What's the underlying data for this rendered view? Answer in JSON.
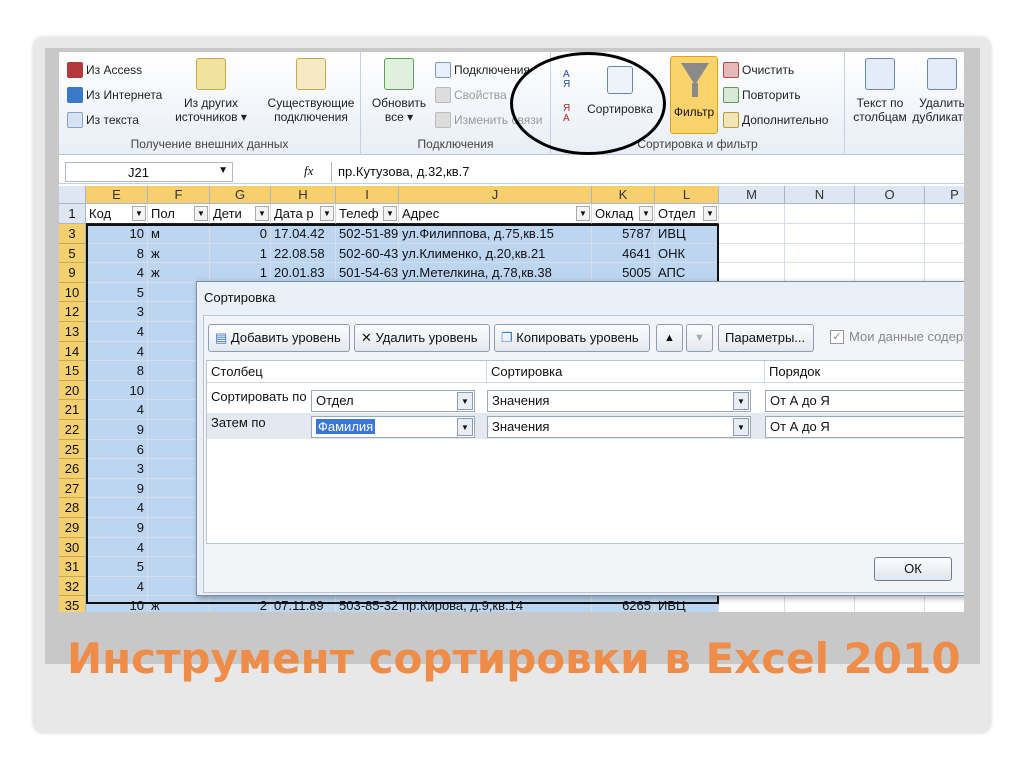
{
  "ribbon": {
    "external_data": {
      "from_access": "Из Access",
      "from_web": "Из Интернета",
      "from_text": "Из текста",
      "other_sources": [
        "Из других",
        "источников ▾"
      ],
      "existing_connections": [
        "Существующие",
        "подключения"
      ],
      "group_label": "Получение внешних данных"
    },
    "connections": {
      "refresh_all": [
        "Обновить",
        "все ▾"
      ],
      "connections": "Подключения",
      "properties": "Свойства",
      "edit_links": "Изменить связи",
      "group_label": "Подключения"
    },
    "sort_filter": {
      "sort": "Сортировка",
      "filter": "Фильтр",
      "clear": "Очистить",
      "reapply": "Повторить",
      "advanced": "Дополнительно",
      "group_label": "Сортировка и фильтр",
      "az_glyph": "А Я",
      "za_glyph": "Я А"
    },
    "tools": {
      "text_to_columns": [
        "Текст по",
        "столбцам"
      ],
      "remove_duplicates": [
        "Удалить",
        "дубликаты"
      ]
    }
  },
  "formula_bar": {
    "name_box": "J21",
    "fx": "fx",
    "value": "пр.Кутузова, д.32,кв.7"
  },
  "sheet": {
    "columns": [
      "E",
      "F",
      "G",
      "H",
      "I",
      "J",
      "K",
      "L",
      "M",
      "N",
      "O",
      "P"
    ],
    "header_row": {
      "row_num": "1",
      "cells": [
        "Код",
        "Пол",
        "Дети",
        "Дата р",
        "Телеф",
        "Адрес",
        "Оклад",
        "Отдел"
      ]
    },
    "rows": [
      {
        "num": "3",
        "code": "10",
        "sex": "м",
        "kids": "0",
        "date": "17.04.42",
        "phone": "502-51-89",
        "address": "ул.Филиппова, д.75,кв.15",
        "salary": "5787",
        "dept": "ИВЦ"
      },
      {
        "num": "5",
        "code": "8",
        "sex": "ж",
        "kids": "1",
        "date": "22.08.58",
        "phone": "502-60-43",
        "address": "ул.Клименко, д.20,кв.21",
        "salary": "4641",
        "dept": "ОНК"
      },
      {
        "num": "9",
        "code": "4",
        "sex": "ж",
        "kids": "1",
        "date": "20.01.83",
        "phone": "501-54-63",
        "address": "ул.Метелкина, д.78,кв.38",
        "salary": "5005",
        "dept": "АПС"
      },
      {
        "num": "10",
        "code": "5"
      },
      {
        "num": "12",
        "code": "3"
      },
      {
        "num": "13",
        "code": "4"
      },
      {
        "num": "14",
        "code": "4"
      },
      {
        "num": "15",
        "code": "8"
      },
      {
        "num": "20",
        "code": "10"
      },
      {
        "num": "21",
        "code": "4"
      },
      {
        "num": "22",
        "code": "9"
      },
      {
        "num": "25",
        "code": "6"
      },
      {
        "num": "26",
        "code": "3"
      },
      {
        "num": "27",
        "code": "9"
      },
      {
        "num": "28",
        "code": "4"
      },
      {
        "num": "29",
        "code": "9"
      },
      {
        "num": "30",
        "code": "4"
      },
      {
        "num": "31",
        "code": "5"
      },
      {
        "num": "32",
        "code": "4"
      },
      {
        "num": "35",
        "code": "10",
        "sex": "ж",
        "kids": "2",
        "date": "07.11.89",
        "phone": "503-85-32",
        "address": "пр.Кирова, д.9,кв.14",
        "salary": "6265",
        "dept": "ИВЦ"
      }
    ]
  },
  "dialog": {
    "title": "Сортировка",
    "add_level": "Добавить уровень",
    "delete_level": "Удалить уровень",
    "copy_level": "Копировать уровень",
    "up": "▲",
    "down": "▼",
    "options": "Параметры...",
    "my_data_headers": "Мои данные содержат заголовки",
    "col_header_column": "Столбец",
    "col_header_sort_on": "Сортировка",
    "col_header_order": "Порядок",
    "levels": [
      {
        "label": "Сортировать по",
        "column": "Отдел",
        "sort_on": "Значения",
        "order": "От А до Я"
      },
      {
        "label": "Затем по",
        "column": "Фамилия",
        "sort_on": "Значения",
        "order": "От А до Я"
      }
    ],
    "ok": "ОК"
  },
  "slide_title": "Инструмент сортировки в Excel 2010",
  "colors": {
    "title": "#ef8c48",
    "selection": "#bcd6f2",
    "header_selected": "#f7cf6d"
  }
}
